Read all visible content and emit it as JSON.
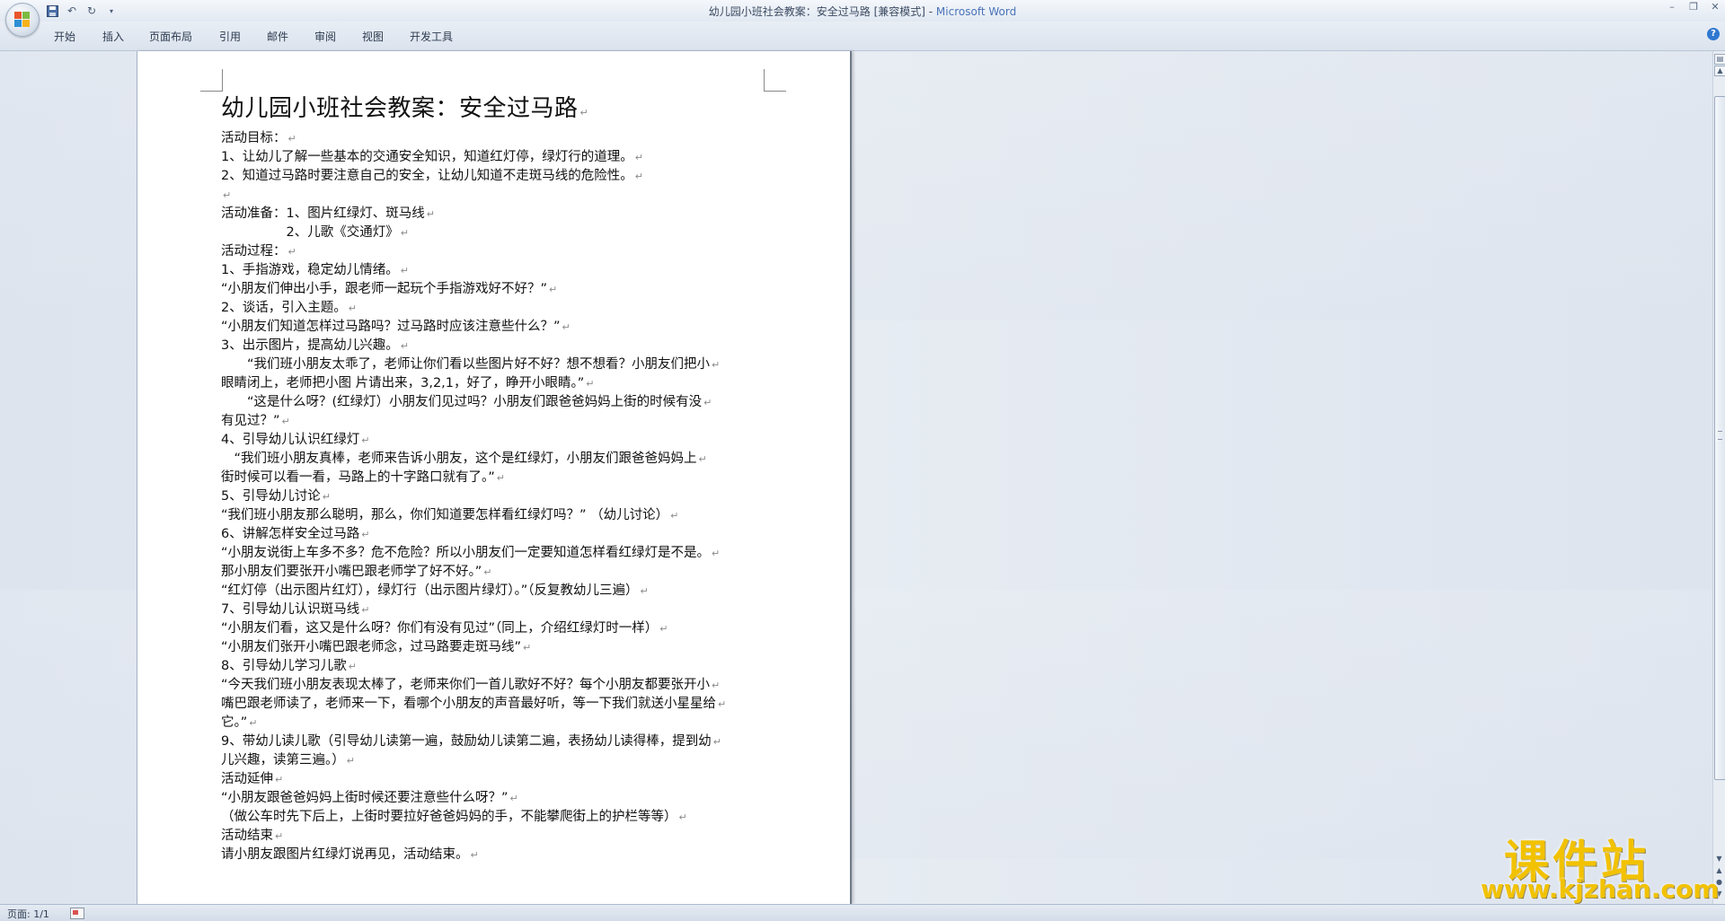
{
  "window": {
    "title_doc": "幼儿园小班社会教案：安全过马路 [兼容模式] - ",
    "title_app": "Microsoft Word"
  },
  "qat": {
    "undo_icon": "undo-icon",
    "redo_icon": "redo-icon",
    "save_icon": "save-icon"
  },
  "tabs": [
    "开始",
    "插入",
    "页面布局",
    "引用",
    "邮件",
    "审阅",
    "视图",
    "开发工具"
  ],
  "document": {
    "title": "幼儿园小班社会教案：安全过马路",
    "lines": [
      "活动目标：",
      "1、让幼儿了解一些基本的交通安全知识，知道红灯停，绿灯行的道理。",
      "2、知道过马路时要注意自己的安全，让幼儿知道不走斑马线的危险性。",
      "",
      "活动准备：1、图片红绿灯、斑马线",
      "　　　　　2、儿歌《交通灯》",
      "活动过程：",
      "1、手指游戏，稳定幼儿情绪。",
      "“小朋友们伸出小手，跟老师一起玩个手指游戏好不好？”",
      "2、谈话，引入主题。",
      "“小朋友们知道怎样过马路吗？过马路时应该注意些什么？”",
      "3、出示图片，提高幼儿兴趣。",
      "　　“我们班小朋友太乖了，老师让你们看以些图片好不好？想不想看？小朋友们把小",
      "眼睛闭上，老师把小图 片请出来，3,2,1，好了，睁开小眼睛。”",
      "　　“这是什么呀？(红绿灯）小朋友们见过吗？小朋友们跟爸爸妈妈上街的时候有没",
      "有见过？”",
      "4、引导幼儿认识红绿灯",
      "　“我们班小朋友真棒，老师来告诉小朋友，这个是红绿灯，小朋友们跟爸爸妈妈上",
      "街时候可以看一看，马路上的十字路口就有了。”",
      "5、引导幼儿讨论",
      "“我们班小朋友那么聪明，那么，你们知道要怎样看红绿灯吗？” （幼儿讨论）",
      "6、讲解怎样安全过马路",
      "“小朋友说街上车多不多？危不危险？所以小朋友们一定要知道怎样看红绿灯是不是。",
      "那小朋友们要张开小嘴巴跟老师学了好不好。”",
      "“红灯停（出示图片红灯），绿灯行（出示图片绿灯）。”（反复教幼儿三遍）",
      "7、引导幼儿认识斑马线",
      "“小朋友们看，这又是什么呀？你们有没有见过”（同上，介绍红绿灯时一样）",
      "  “小朋友们张开小嘴巴跟老师念，过马路要走斑马线”",
      "8、引导幼儿学习儿歌",
      "“今天我们班小朋友表现太棒了，老师来你们一首儿歌好不好？每个小朋友都要张开小",
      "嘴巴跟老师读了，老师来一下，看哪个小朋友的声音最好听，等一下我们就送小星星给",
      "它。”",
      "9、带幼儿读儿歌（引导幼儿读第一遍，鼓励幼儿读第二遍，表扬幼儿读得棒，提到幼",
      "儿兴趣，读第三遍。）",
      "活动延伸",
      "“小朋友跟爸爸妈妈上街时候还要注意些什么呀？”",
      "（做公车时先下后上，上街时要拉好爸爸妈妈的手，不能攀爬街上的护栏等等）",
      "活动结束",
      "请小朋友跟图片红绿灯说再见，活动结束。"
    ],
    "paragraph_mark": "↵"
  },
  "status": {
    "page": "页面: 1/1"
  },
  "watermark": {
    "title": "课件站",
    "url": "www.kjzhan.com"
  }
}
